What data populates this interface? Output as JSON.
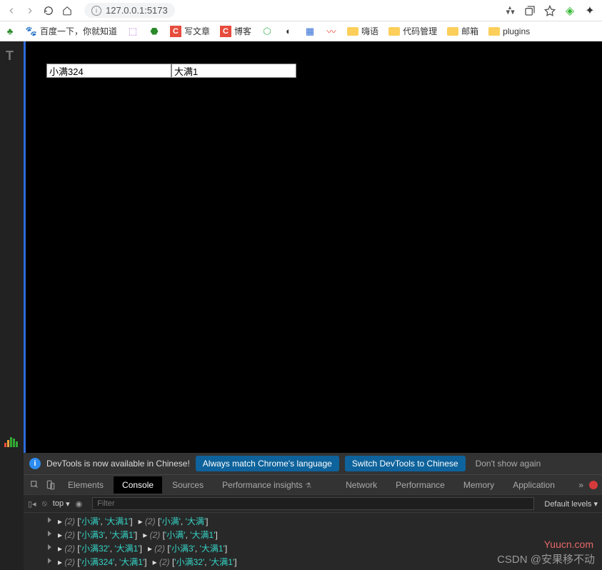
{
  "toolbar": {
    "url": "127.0.0.1:5173"
  },
  "bookmarks": {
    "baidu": "百度一下，你就知道",
    "write": "写文章",
    "blog": "博客",
    "hai": "嗨语",
    "code": "代码管理",
    "mail": "邮箱",
    "plugins": "plugins"
  },
  "page": {
    "input1_value": "小满324",
    "input2_value": "大满1"
  },
  "devtools": {
    "banner": {
      "text": "DevTools is now available in Chinese!",
      "btn1": "Always match Chrome's language",
      "btn2": "Switch DevTools to Chinese",
      "dismiss": "Don't show again"
    },
    "tabs": {
      "elements": "Elements",
      "console": "Console",
      "sources": "Sources",
      "perf_insights": "Performance insights",
      "network": "Network",
      "performance": "Performance",
      "memory": "Memory",
      "application": "Application"
    },
    "filter": {
      "context": "top",
      "placeholder": "Filter",
      "levels": "Default levels"
    },
    "logs": [
      {
        "a": {
          "n": "(2)",
          "items": [
            "'小满'",
            "'大满1'"
          ]
        },
        "b": {
          "n": "(2)",
          "items": [
            "'小满'",
            "'大满'"
          ]
        }
      },
      {
        "a": {
          "n": "(2)",
          "items": [
            "'小满3'",
            "'大满1'"
          ]
        },
        "b": {
          "n": "(2)",
          "items": [
            "'小满'",
            "'大满1'"
          ]
        }
      },
      {
        "a": {
          "n": "(2)",
          "items": [
            "'小满32'",
            "'大满1'"
          ]
        },
        "b": {
          "n": "(2)",
          "items": [
            "'小满3'",
            "'大满1'"
          ]
        }
      },
      {
        "a": {
          "n": "(2)",
          "items": [
            "'小满324'",
            "'大满1'"
          ]
        },
        "b": {
          "n": "(2)",
          "items": [
            "'小满32'",
            "'大满1'"
          ]
        }
      }
    ]
  },
  "watermarks": {
    "w1": "Yuucn.com",
    "w2": "CSDN @安果移不动"
  }
}
